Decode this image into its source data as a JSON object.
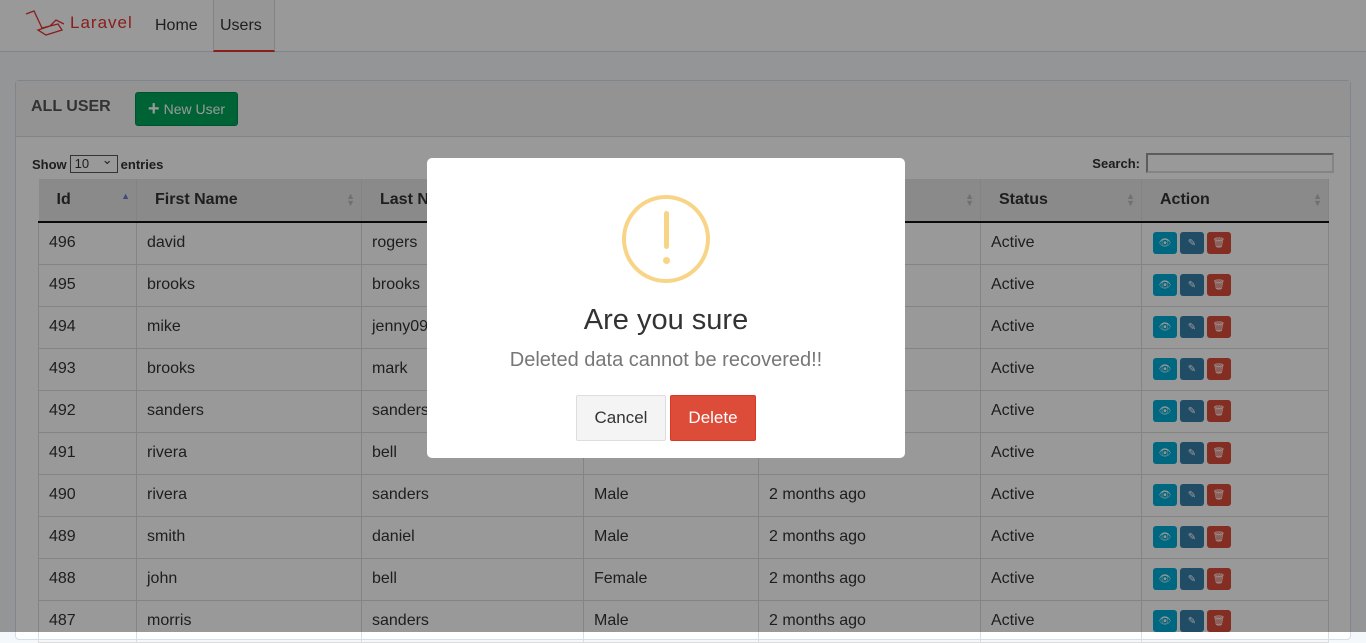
{
  "navbar": {
    "brand": "Laravel",
    "links": [
      {
        "label": "Home"
      },
      {
        "label": "Users",
        "active": true
      }
    ]
  },
  "panel": {
    "title": "ALL USER",
    "new_button": "New User",
    "new_icon": "plus-icon"
  },
  "datatable": {
    "show_label": "Show",
    "entries_value": "10",
    "entries_label": "entries",
    "search_label": "Search:",
    "search_value": ""
  },
  "table": {
    "columns": [
      "Id",
      "First Name",
      "Last N",
      "",
      "",
      "Status",
      "Action"
    ],
    "rows": [
      [
        "496",
        "david",
        "rogers",
        "",
        "",
        "Active"
      ],
      [
        "495",
        "brooks",
        "brooks",
        "",
        "",
        "Active"
      ],
      [
        "494",
        "mike",
        "jenny09",
        "",
        "",
        "Active"
      ],
      [
        "493",
        "brooks",
        "mark",
        "",
        "",
        "Active"
      ],
      [
        "492",
        "sanders",
        "sanders",
        "",
        "",
        "Active"
      ],
      [
        "491",
        "rivera",
        "bell",
        "",
        "",
        "Active"
      ],
      [
        "490",
        "rivera",
        "sanders",
        "Male",
        "2 months ago",
        "Active"
      ],
      [
        "489",
        "smith",
        "daniel",
        "Male",
        "2 months ago",
        "Active"
      ],
      [
        "488",
        "john",
        "bell",
        "Female",
        "2 months ago",
        "Active"
      ],
      [
        "487",
        "morris",
        "sanders",
        "Male",
        "2 months ago",
        "Active"
      ]
    ],
    "action_icons": [
      "eye-icon",
      "edit-icon",
      "trash-icon"
    ],
    "action_colors": {
      "view": "#00acd6",
      "edit": "#367fa9",
      "delete": "#dd4b39"
    }
  },
  "modal": {
    "icon": "warning-icon",
    "title": "Are you sure",
    "text": "Deleted data cannot be recovered!!",
    "cancel": "Cancel",
    "confirm": "Delete",
    "warning_color": "#f8d486"
  }
}
